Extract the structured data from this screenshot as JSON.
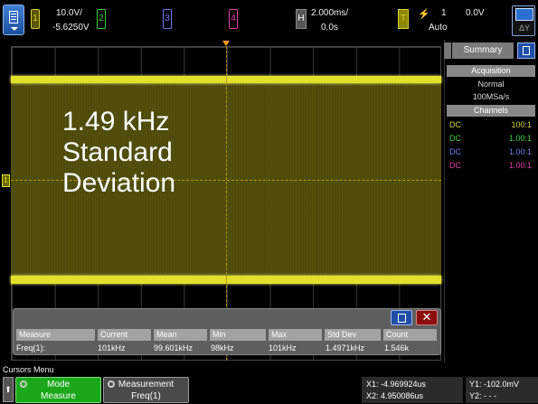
{
  "colors": {
    "ch1": "#d6d23a",
    "ch2": "#3ccf3c",
    "ch3": "#6f7df0",
    "ch4": "#e23ca8",
    "accent_blue": "#1f4fa8",
    "softkey_green": "#1aa81a",
    "trace": "#e3e02c"
  },
  "top_bar": {
    "menu_icon": "menu-icon",
    "ch1": {
      "number": "1",
      "scale": "10.0V/",
      "offset": "-5.6250V"
    },
    "ch2": {
      "number": "2"
    },
    "ch3": {
      "number": "3"
    },
    "ch4": {
      "number": "4"
    },
    "horizontal": {
      "badge": "H",
      "timebase": "2.000ms/",
      "delay": "0.0s"
    },
    "trigger": {
      "badge": "T",
      "icon": "trigger-edge-icon",
      "source": "1",
      "level": "0.0V",
      "mode": "Auto"
    },
    "display_icon": "display-icon",
    "delta_icon_label": "ΔY"
  },
  "graticule": {
    "channel_marker": "1",
    "overlay_lines": [
      "1.49 kHz",
      "Standard",
      "Deviation"
    ]
  },
  "measurement_panel": {
    "headers": [
      "Measure",
      "Current",
      "Mean",
      "Min",
      "Max",
      "Std Dev",
      "Count"
    ],
    "row": {
      "measure": "Freq(1):",
      "current": "101kHz",
      "mean": "99.601kHz",
      "min": "98kHz",
      "max": "101kHz",
      "std_dev": "1.4971kHz",
      "count": "1.546k"
    },
    "close_label": "✕"
  },
  "side_panel": {
    "tab": "Summary",
    "acquisition_header": "Acquisition",
    "acq_mode": "Normal",
    "sample_rate": "100MSa/s",
    "channels_header": "Channels",
    "channels": [
      {
        "coupling": "DC",
        "probe": "100:1",
        "color": "#d6d23a"
      },
      {
        "coupling": "DC",
        "probe": "1.00:1",
        "color": "#3ccf3c"
      },
      {
        "coupling": "DC",
        "probe": "1.00:1",
        "color": "#6f7df0"
      },
      {
        "coupling": "DC",
        "probe": "1.00:1",
        "color": "#e23ca8"
      }
    ]
  },
  "bottom_bar": {
    "menu_title": "Cursors Menu",
    "up_button": "⬆",
    "softkeys": [
      {
        "line1": "Mode",
        "line2": "Measure"
      },
      {
        "line1": "Measurement",
        "line2": "Freq(1)"
      }
    ],
    "cursors": {
      "x1": "X1: -4.969924us",
      "x2": "X2: 4.950086us",
      "y1": "Y1: -102.0mV",
      "y2": "Y2: - - -"
    }
  }
}
